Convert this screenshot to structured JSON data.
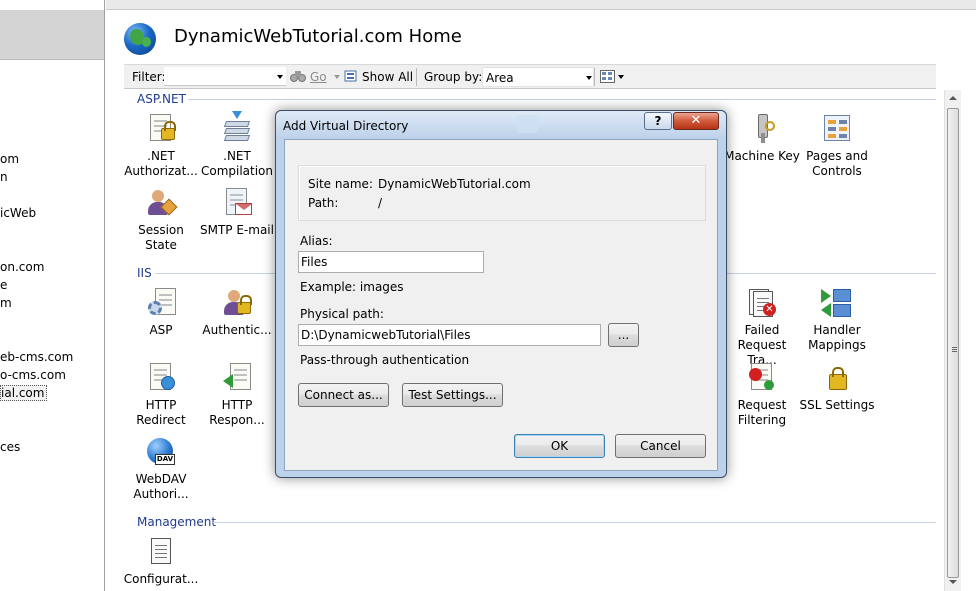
{
  "left_tree": {
    "items": [
      "om",
      "n",
      "icWeb",
      "on.com",
      "e",
      "m",
      "eb-cms.com",
      "o-cms.com",
      "ial.com",
      "ces"
    ],
    "selected_index": 8
  },
  "header": {
    "title": "DynamicWebTutorial.com Home"
  },
  "filterbar": {
    "filter_label": "Filter:",
    "filter_value": "",
    "go_label": "Go",
    "show_all_label": "Show All",
    "group_by_label": "Group by:",
    "group_by_value": "Area"
  },
  "sections": {
    "aspnet": {
      "title": "ASP.NET",
      "items": [
        {
          "label": ".NET Authorizat...",
          "icon": "dotnet-authorization-icon"
        },
        {
          "label": ".NET Compilation",
          "icon": "dotnet-compilation-icon"
        },
        {
          "label": "Machine Key",
          "icon": "machine-key-icon"
        },
        {
          "label": "Pages and Controls",
          "icon": "pages-and-controls-icon"
        },
        {
          "label": "Session State",
          "icon": "session-state-icon"
        },
        {
          "label": "SMTP E-mail",
          "icon": "smtp-email-icon"
        }
      ]
    },
    "iis": {
      "title": "IIS",
      "items": [
        {
          "label": "ASP",
          "icon": "asp-icon"
        },
        {
          "label": "Authentic...",
          "icon": "authentication-icon"
        },
        {
          "label": "Failed Request Tra...",
          "icon": "failed-request-tracing-icon"
        },
        {
          "label": "Handler Mappings",
          "icon": "handler-mappings-icon"
        },
        {
          "label": "HTTP Redirect",
          "icon": "http-redirect-icon"
        },
        {
          "label": "HTTP Respon...",
          "icon": "http-response-headers-icon"
        },
        {
          "label": "Request Filtering",
          "icon": "request-filtering-icon"
        },
        {
          "label": "SSL Settings",
          "icon": "ssl-settings-icon"
        },
        {
          "label": "WebDAV Authori...",
          "icon": "webdav-authoring-icon"
        }
      ]
    },
    "management": {
      "title": "Management",
      "items": [
        {
          "label": "Configurat...",
          "icon": "configuration-editor-icon"
        }
      ]
    }
  },
  "dialog": {
    "title": "Add Virtual Directory",
    "help_label": "?",
    "close_label": "✕",
    "site_name_label": "Site name:",
    "site_name_value": "DynamicWebTutorial.com",
    "path_label": "Path:",
    "path_value": "/",
    "alias_label": "Alias:",
    "alias_value": "Files",
    "alias_example": "Example: images",
    "physical_path_label": "Physical path:",
    "physical_path_value": "D:\\DynamicwebTutorial\\Files",
    "browse_label": "...",
    "passthrough_label": "Pass-through authentication",
    "connect_as_label": "Connect as...",
    "test_settings_label": "Test Settings...",
    "ok_label": "OK",
    "cancel_label": "Cancel"
  },
  "colors": {
    "section_title": "#1e3b8f",
    "dialog_frame": "#bcd1ea",
    "close_button": "#d05a3c"
  }
}
